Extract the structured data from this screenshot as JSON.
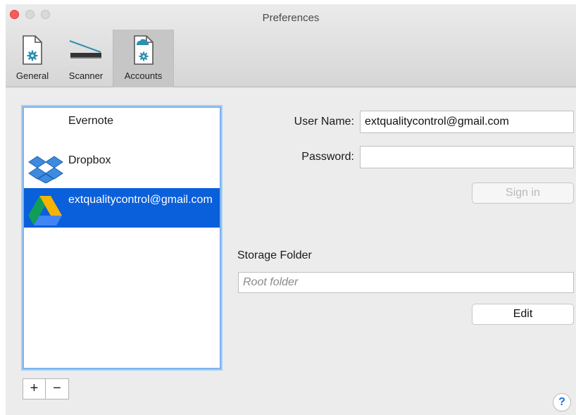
{
  "window": {
    "title": "Preferences"
  },
  "toolbar": {
    "tabs": [
      {
        "label": "General",
        "icon": "general-doc-gear-icon"
      },
      {
        "label": "Scanner",
        "icon": "scanner-icon"
      },
      {
        "label": "Accounts",
        "icon": "accounts-cloud-doc-icon"
      }
    ],
    "selected": "Accounts"
  },
  "accounts": {
    "items": [
      {
        "label": "Evernote",
        "icon": ""
      },
      {
        "label": "Dropbox",
        "icon": "dropbox-icon"
      },
      {
        "label": "extqualitycontrol@gmail.com",
        "icon": "google-drive-icon",
        "selected": true
      }
    ],
    "add_label": "+",
    "remove_label": "−"
  },
  "form": {
    "username_label": "User Name:",
    "username_value": "extqualitycontrol@gmail.com",
    "password_label": "Password:",
    "password_value": "",
    "signin_label": "Sign in",
    "storage_label": "Storage Folder",
    "storage_placeholder": "Root folder",
    "edit_label": "Edit"
  },
  "help_label": "?",
  "colors": {
    "selection": "#0a5fdb",
    "close": "#fc5b57",
    "help": "#1e6ed6"
  }
}
